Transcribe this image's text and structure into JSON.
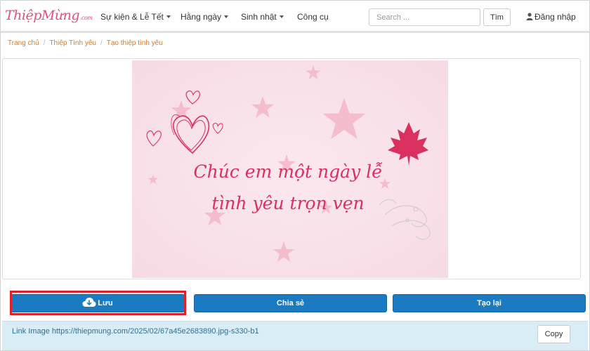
{
  "logo": {
    "text": "ThiệpMừng",
    "domain": ".com"
  },
  "nav": {
    "items": [
      {
        "label": "Sự kiện & Lễ Tết",
        "dropdown": true
      },
      {
        "label": "Hằng ngày",
        "dropdown": true
      },
      {
        "label": "Sinh nhật",
        "dropdown": true
      },
      {
        "label": "Công cụ",
        "dropdown": false
      }
    ],
    "search_placeholder": "Search ...",
    "search_button": "Tìm",
    "login": "Đăng nhập"
  },
  "breadcrumb": [
    "Trang chủ",
    "Thiệp Tình yêu",
    "Tạo thiệp tình yêu"
  ],
  "card": {
    "message_line1": "Chúc em một ngày lễ",
    "message_line2": "tình yêu trọn vẹn",
    "background_color": "#f9e1e8",
    "accent_color": "#d9305f"
  },
  "actions": {
    "save": "Lưu",
    "share": "Chia sẻ",
    "recreate": "Tạo lại",
    "button_color": "#1a7bc3",
    "highlight_color": "#e01f26"
  },
  "link": {
    "text": "Link Image https://thiepmung.com/2025/02/67a45e2683890.jpg-s330-b1",
    "copy_button": "Copy"
  }
}
